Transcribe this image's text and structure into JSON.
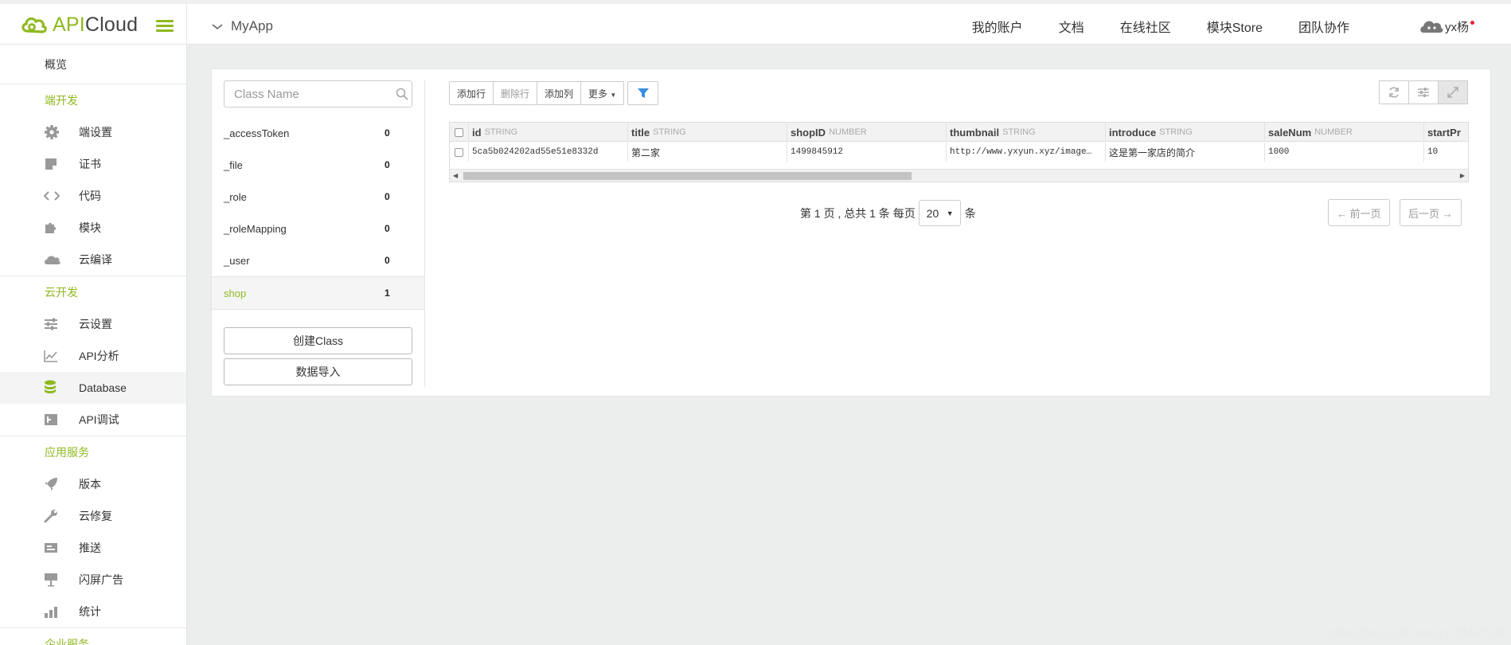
{
  "brand": {
    "name_part1": "API",
    "name_part2": "Cloud",
    "accent": "#8fb920"
  },
  "header": {
    "app_name": "MyApp",
    "nav": [
      "我的账户",
      "文档",
      "在线社区",
      "模块Store",
      "团队协作"
    ],
    "user": "yx杨"
  },
  "sidebar": {
    "overview": "概览",
    "group1": "端开发",
    "group1_items": [
      {
        "label": "端设置",
        "icon": "gear-icon"
      },
      {
        "label": "证书",
        "icon": "certificate-icon"
      },
      {
        "label": "代码",
        "icon": "code-icon"
      },
      {
        "label": "模块",
        "icon": "puzzle-icon"
      },
      {
        "label": "云编译",
        "icon": "cloud-icon"
      }
    ],
    "group2": "云开发",
    "group2_items": [
      {
        "label": "云设置",
        "icon": "sliders-icon"
      },
      {
        "label": "API分析",
        "icon": "line-chart-icon"
      },
      {
        "label": "Database",
        "icon": "database-icon"
      },
      {
        "label": "API调试",
        "icon": "debug-icon"
      }
    ],
    "group3": "应用服务",
    "group3_items": [
      {
        "label": "版本",
        "icon": "rocket-icon"
      },
      {
        "label": "云修复",
        "icon": "wrench-icon"
      },
      {
        "label": "推送",
        "icon": "push-icon"
      },
      {
        "label": "闪屏广告",
        "icon": "billboard-icon"
      },
      {
        "label": "统计",
        "icon": "bar-chart-icon"
      }
    ],
    "group4": "企业服务"
  },
  "classes": {
    "search_placeholder": "Class Name",
    "items": [
      {
        "name": "_accessToken",
        "count": "0"
      },
      {
        "name": "_file",
        "count": "0"
      },
      {
        "name": "_role",
        "count": "0"
      },
      {
        "name": "_roleMapping",
        "count": "0"
      },
      {
        "name": "_user",
        "count": "0"
      },
      {
        "name": "shop",
        "count": "1"
      }
    ],
    "create_button": "创建Class",
    "import_button": "数据导入"
  },
  "toolbar": {
    "add_row": "添加行",
    "delete_row": "删除行",
    "add_column": "添加列",
    "more": "更多"
  },
  "table": {
    "columns": [
      {
        "name": "id",
        "type": "STRING"
      },
      {
        "name": "title",
        "type": "STRING"
      },
      {
        "name": "shopID",
        "type": "NUMBER"
      },
      {
        "name": "thumbnail",
        "type": "STRING"
      },
      {
        "name": "introduce",
        "type": "STRING"
      },
      {
        "name": "saleNum",
        "type": "NUMBER"
      },
      {
        "name": "startPr",
        "type": ""
      }
    ],
    "rows": [
      [
        "5ca5b024202ad55e51e8332d",
        "第二家",
        "1499845912",
        "http://www.yxyun.xyz/image…",
        "这是第一家店的简介",
        "1000",
        "10"
      ]
    ]
  },
  "pagination": {
    "prefix": "第 1 页 , 总共 1 条 每页",
    "page_size": "20",
    "suffix": "条",
    "prev": "← 前一页",
    "next": "后一页 →"
  },
  "watermark": "https://blog.csdn.net/qq_35445741"
}
